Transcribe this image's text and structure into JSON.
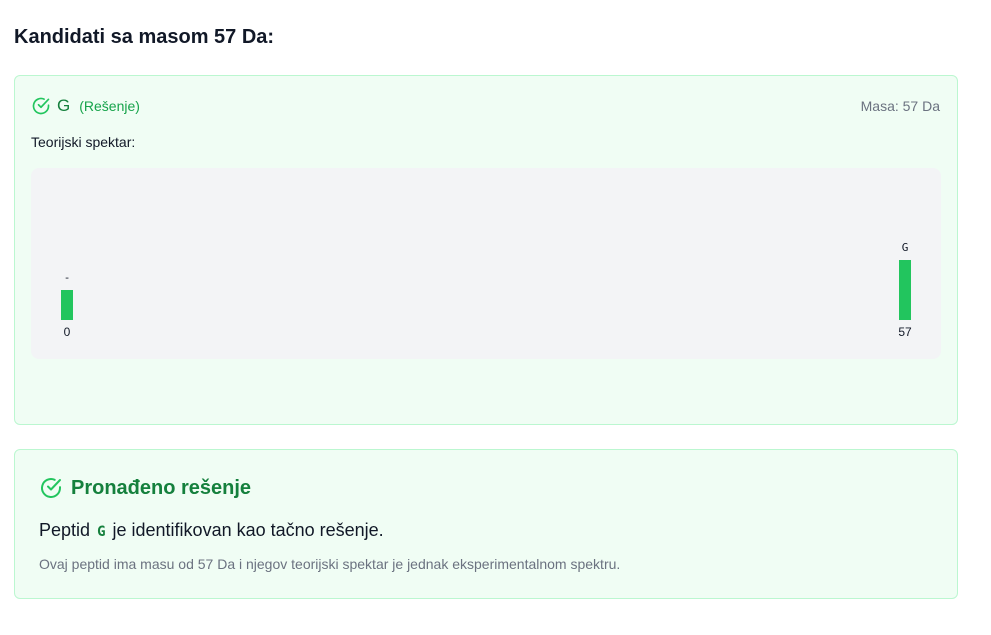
{
  "heading": "Kandidati sa masom 57 Da:",
  "candidate": {
    "peptide": "G",
    "tag": "(Rešenje)",
    "mass_text": "Masa: 57 Da",
    "spectrum_label": "Teorijski spektar:",
    "spectrum": {
      "type": "bar",
      "categories": [
        "0",
        "57"
      ],
      "x": [
        0,
        57
      ],
      "values": [
        1,
        2
      ],
      "peak_labels": [
        "-",
        "G"
      ],
      "xlim": [
        0,
        57
      ]
    }
  },
  "result": {
    "title": "Pronađeno rešenje",
    "text_before": "Peptid",
    "peptide": "G",
    "text_after": "je identifikovan kao tačno rešenje.",
    "subtext": "Ovaj peptid ima masu od 57 Da i njegov teorijski spektar je jednak eksperimentalnom spektru."
  },
  "colors": {
    "accent": "#22c55e",
    "accent_dark": "#15803d",
    "card_bg": "#f0fdf4",
    "card_border": "#bbf7d0"
  },
  "icons": {
    "candidate_status": "circle-check-icon",
    "result_status": "circle-check-icon"
  }
}
